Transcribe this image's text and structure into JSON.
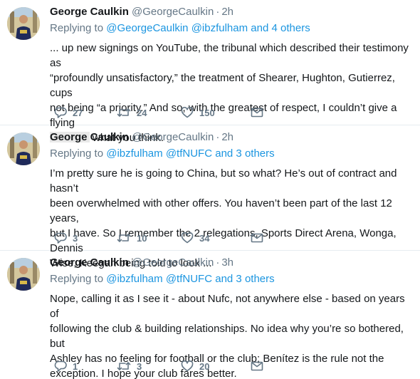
{
  "tweets": [
    {
      "name": "George Caulkin",
      "handle": "@GeorgeCaulkin",
      "time": "2h",
      "replying_prefix": "Replying to",
      "replying_to": [
        "@GeorgeCaulkin",
        "@ibzfulham"
      ],
      "replying_suffix": "and 4 others",
      "text_main": "... up new signings on YouTube, the tribunal which described their testimony as \n“profoundly unsatisfactory,” the treatment of Shearer, Hughton, Gutierrez, cups \nnot being “a priority.” And so, with the greatest of respect, I couldn’t give a flying",
      "text_tail": "what you think.",
      "replies": "27",
      "retweets": "24",
      "likes": "150"
    },
    {
      "name": "George Caulkin",
      "handle": "@GeorgeCaulkin",
      "time": "2h",
      "replying_prefix": "Replying to",
      "replying_to": [
        "@ibzfulham",
        "@tfNUFC"
      ],
      "replying_suffix": "and 3 others",
      "text_main": "I’m pretty sure he is going to China, but so what? He’s out of contract and hasn’t \nbeen overwhelmed with other offers. You haven’t been part of the last 12 years, \nbut I have. So I remember the 2 relegations, Sports Direct Arena, Wonga, Dennis \nWise, Keegan being told to look ...",
      "replies": "3",
      "retweets": "10",
      "likes": "34"
    },
    {
      "name": "George Caulkin",
      "handle": "@GeorgeCaulkin",
      "time": "3h",
      "replying_prefix": "Replying to",
      "replying_to": [
        "@ibzfulham",
        "@tfNUFC"
      ],
      "replying_suffix": "and 3 others",
      "text_main": "Nope, calling it as I see it - about Nufc, not anywhere else - based on years of \nfollowing the club & building relationships. No idea why you’re so bothered, but \nAshley has no feeling for football or the club; Benítez is the rule not the \nexception. I hope your club fares better.",
      "replies": "1",
      "retweets": "3",
      "likes": "20"
    }
  ],
  "separator": "·",
  "icons": {
    "reply": "reply-icon",
    "retweet": "retweet-icon",
    "like": "like-heart-icon",
    "dm": "direct-message-icon"
  },
  "colors": {
    "link": "#1b95e0",
    "muted": "#657786",
    "text": "#14171a",
    "border": "#e6ecf0"
  }
}
